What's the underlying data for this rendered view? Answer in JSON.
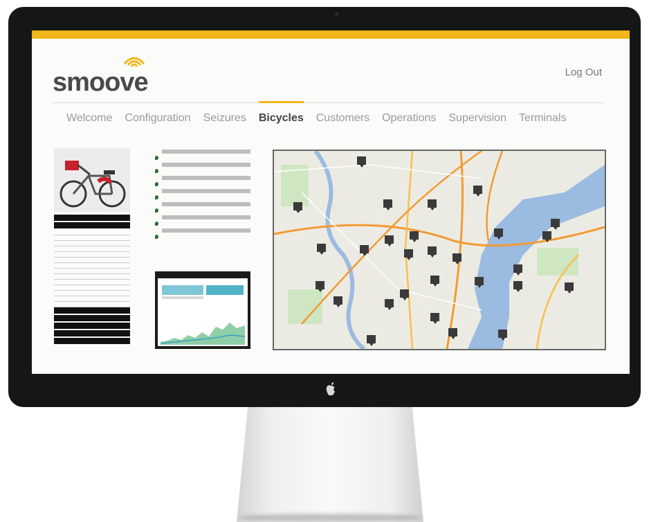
{
  "app": {
    "logo_text": "smoove",
    "logout_label": "Log Out",
    "accent_color": "#f2b61b"
  },
  "nav": {
    "tabs": [
      {
        "label": "Welcome"
      },
      {
        "label": "Configuration"
      },
      {
        "label": "Seizures"
      },
      {
        "label": "Bicycles",
        "active": true
      },
      {
        "label": "Customers"
      },
      {
        "label": "Operations"
      },
      {
        "label": "Supervision"
      },
      {
        "label": "Terminals"
      }
    ]
  },
  "icons": {
    "logo": "wifi-waves-icon",
    "map_marker": "bike-station-marker-icon",
    "chin": "apple-logo-icon"
  },
  "map": {
    "marker_count": 28
  }
}
